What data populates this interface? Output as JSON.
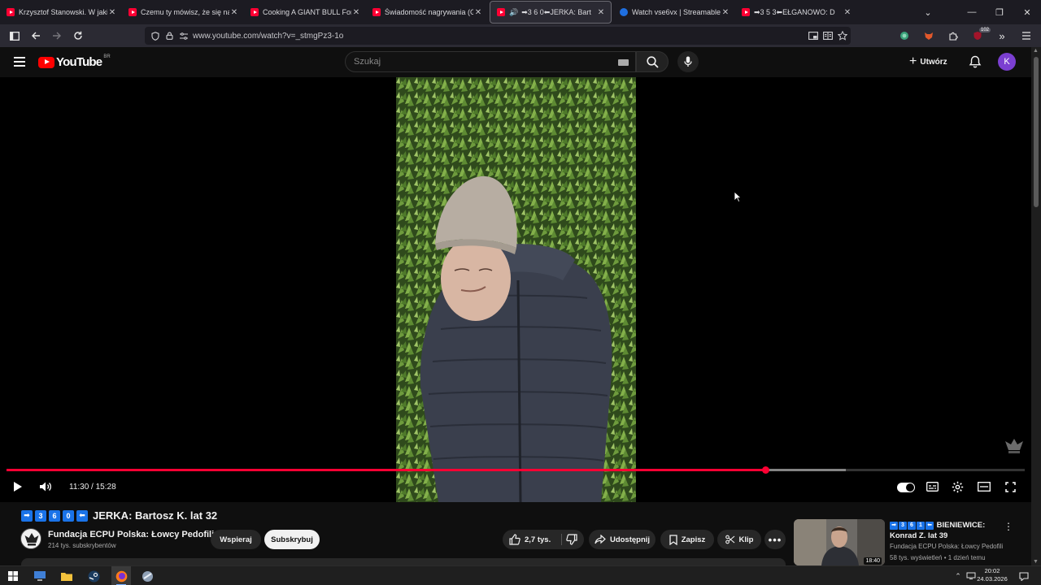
{
  "browser": {
    "tabs": [
      {
        "title": "Krzysztof Stanowski. W jakiej sp",
        "favicon": "youtube-icon",
        "active": false
      },
      {
        "title": "Czemu ty mówisz, że się na cieb",
        "favicon": "youtube-icon",
        "active": false
      },
      {
        "title": "Cooking A GIANT BULL For A G",
        "favicon": "youtube-icon",
        "active": false
      },
      {
        "title": "Świadomość nagrywania (Giełd",
        "favicon": "youtube-icon",
        "active": false
      },
      {
        "title": "➡3 6 0⬅JERKA: Bart",
        "favicon": "youtube-icon",
        "active": true,
        "audio": true
      },
      {
        "title": "Watch vse6vx | Streamable",
        "favicon": "streamable-icon",
        "active": false
      },
      {
        "title": "➡3 5 3⬅EŁGANOWO: D",
        "favicon": "youtube-icon",
        "active": false
      }
    ],
    "url": "www.youtube.com/watch?v=_stmgPz3-1o",
    "notification_badge": "102"
  },
  "youtube": {
    "logo_text": "YouTube",
    "country_code": "BR",
    "search_placeholder": "Szukaj",
    "create_label": "Utwórz",
    "avatar_letter": "K"
  },
  "player": {
    "current_time": "11:30",
    "duration": "15:28",
    "time_display": "11:30 / 15:28",
    "played_fraction": 0.745,
    "buffered_fraction": 0.824
  },
  "video": {
    "title_digits": [
      "3",
      "6",
      "0"
    ],
    "title_text": "JERKA: Bartosz K. lat 32",
    "channel_name": "Fundacja ECPU Polska: Łowcy Pedofili",
    "subscribers": "214 tys. subskrybentów",
    "support_label": "Wspieraj",
    "subscribe_label": "Subskrybuj",
    "likes": "2,7 tys.",
    "share_label": "Udostępnij",
    "save_label": "Zapisz",
    "clip_label": "Klip"
  },
  "related": {
    "title_digits": [
      "3",
      "6",
      "1"
    ],
    "title_line1": "BIENIEWICE:",
    "title_line2": "Konrad Z. lat 39",
    "channel": "Fundacja ECPU Polska: Łowcy Pedofili",
    "meta": "58 tys. wyświetleń • 1 dzień temu",
    "duration": "18:40"
  },
  "taskbar": {
    "time": "20:02",
    "date": "24.03.2026"
  },
  "colors": {
    "accent_red": "#ff0033",
    "keycap_blue": "#1a73e8",
    "avatar_purple": "#7b3fd1"
  }
}
